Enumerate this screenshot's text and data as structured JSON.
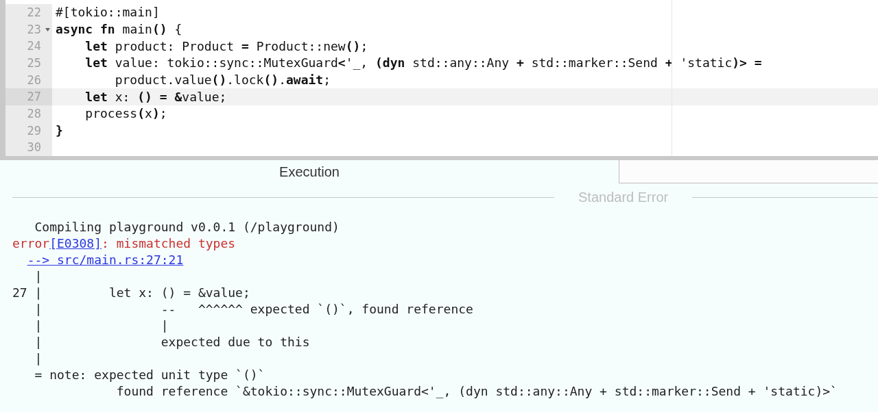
{
  "editor": {
    "lines": [
      {
        "number": "22",
        "code": "#[tokio::main]",
        "foldable": false,
        "active": false
      },
      {
        "number": "23",
        "code": "**async** **fn** main**()** {",
        "foldable": true,
        "active": false
      },
      {
        "number": "24",
        "code": "    **let** product: Product **=** Product::new**()**;",
        "foldable": false,
        "active": false
      },
      {
        "number": "25",
        "code": "    **let** value: tokio::sync::MutexGuard**<**'_, **(dyn** std::any::Any **+** std::marker::Send **+** 'static**)>** **=**",
        "foldable": false,
        "active": false
      },
      {
        "number": "26",
        "code": "        product.value**()**.lock**()**.**await**;",
        "foldable": false,
        "active": false
      },
      {
        "number": "27",
        "code": "    **let** x: **()** **=** **&**value;",
        "foldable": false,
        "active": true
      },
      {
        "number": "28",
        "code": "    process**(**x**)**;",
        "foldable": false,
        "active": false
      },
      {
        "number": "29",
        "code": "**}**",
        "foldable": false,
        "active": false
      },
      {
        "number": "30",
        "foldable": false,
        "active": false
      }
    ]
  },
  "output": {
    "tab": "Execution",
    "section": "Standard Error",
    "lines": [
      [
        {
          "kind": "plain",
          "text": "   Compiling playground v0.0.1 (/playground)"
        }
      ],
      [
        {
          "kind": "error",
          "text": "error"
        },
        {
          "kind": "link",
          "text": "[E0308]"
        },
        {
          "kind": "error",
          "text": ": mismatched types"
        }
      ],
      [
        {
          "kind": "link",
          "text": "--> src/main.rs:27:21"
        }
      ],
      [
        {
          "kind": "plain",
          "text": "   |"
        }
      ],
      [
        {
          "kind": "plain",
          "text": "27 |         let x: () = &value;"
        }
      ],
      [
        {
          "kind": "plain",
          "text": "   |                --   ^^^^^^ expected `()`, found reference"
        }
      ],
      [
        {
          "kind": "plain",
          "text": "   |                |"
        }
      ],
      [
        {
          "kind": "plain",
          "text": "   |                expected due to this"
        }
      ],
      [
        {
          "kind": "plain",
          "text": "   |"
        }
      ],
      [
        {
          "kind": "plain",
          "text": "   = note: expected unit type `()`"
        }
      ],
      [
        {
          "kind": "plain",
          "text": "              found reference `&tokio::sync::MutexGuard<'_, (dyn std::any::Any + std::marker::Send + 'static)>`"
        }
      ]
    ]
  }
}
